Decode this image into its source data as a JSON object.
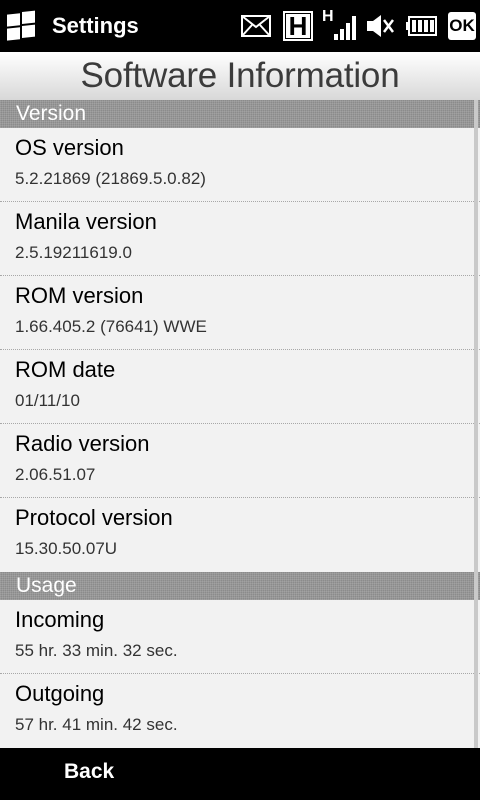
{
  "status_bar": {
    "app_title": "Settings",
    "start_icon": "windows-flag-icon",
    "icons": [
      "message-icon",
      "hsdpa-h-icon",
      "signal-strength-icon",
      "volume-mute-icon",
      "battery-icon",
      "ok-button"
    ],
    "network_indicator": "H",
    "ok_label": "OK"
  },
  "page": {
    "title": "Software Information"
  },
  "sections": [
    {
      "title": "Version",
      "items": [
        {
          "label": "OS version",
          "value": "5.2.21869 (21869.5.0.82)"
        },
        {
          "label": "Manila version",
          "value": "2.5.19211619.0"
        },
        {
          "label": "ROM version",
          "value": "1.66.405.2 (76641) WWE"
        },
        {
          "label": "ROM date",
          "value": "01/11/10"
        },
        {
          "label": "Radio version",
          "value": "2.06.51.07"
        },
        {
          "label": "Protocol version",
          "value": "15.30.50.07U"
        }
      ]
    },
    {
      "title": "Usage",
      "items": [
        {
          "label": "Incoming",
          "value": "55 hr. 33 min. 32 sec."
        },
        {
          "label": "Outgoing",
          "value": "57 hr. 41 min. 42 sec."
        }
      ]
    }
  ],
  "bottom_bar": {
    "back_label": "Back"
  },
  "colors": {
    "background": "#f2f2f2",
    "section_header": "#8b8b8b",
    "status_bar": "#000000"
  }
}
